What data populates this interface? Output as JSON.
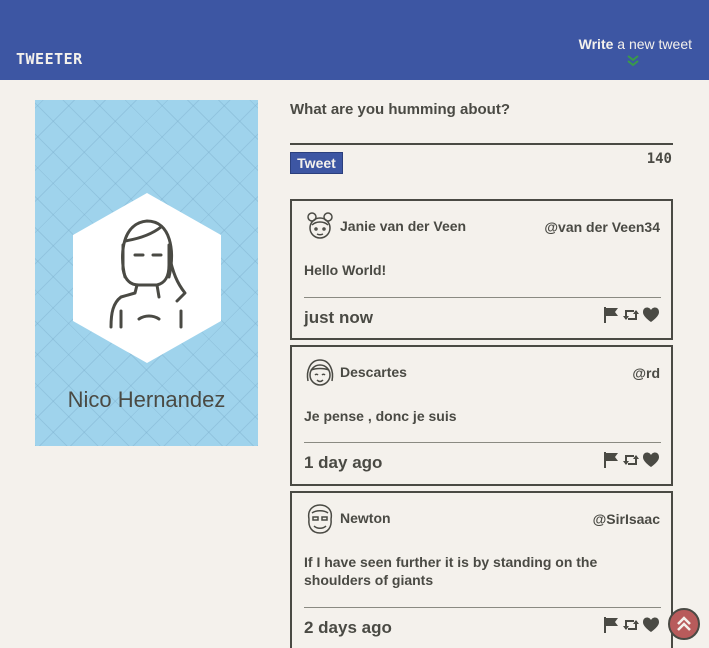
{
  "nav": {
    "brand": "TWEETER",
    "compose_bold": "Write",
    "compose_rest": " a new tweet"
  },
  "profile": {
    "name": "Nico Hernandez"
  },
  "composer": {
    "prompt": "What are you humming about?",
    "button_label": "Tweet",
    "counter": "140"
  },
  "tweets": [
    {
      "name": "Janie van der Veen",
      "handle": "@van der Veen34",
      "text": "Hello World!",
      "time": "just now"
    },
    {
      "name": "Descartes",
      "handle": "@rd",
      "text": "Je pense , donc je suis",
      "time": "1 day ago"
    },
    {
      "name": "Newton",
      "handle": "@SirIsaac",
      "text": "If I have seen further it is by standing on the shoulders of giants",
      "time": "2 days ago"
    }
  ],
  "colors": {
    "nav_bg": "#3d56a3",
    "page_bg": "#f4f1ec",
    "profile_bg": "#9fd3ec",
    "text": "#4a4a44",
    "chevron": "#3a9a4a",
    "scroll_button": "#b85b5b"
  },
  "icons": {
    "actions": [
      "flag-icon",
      "retweet-icon",
      "heart-icon"
    ],
    "compose": "double-chevron-down-icon",
    "scroll_top": "double-chevron-up-icon"
  }
}
